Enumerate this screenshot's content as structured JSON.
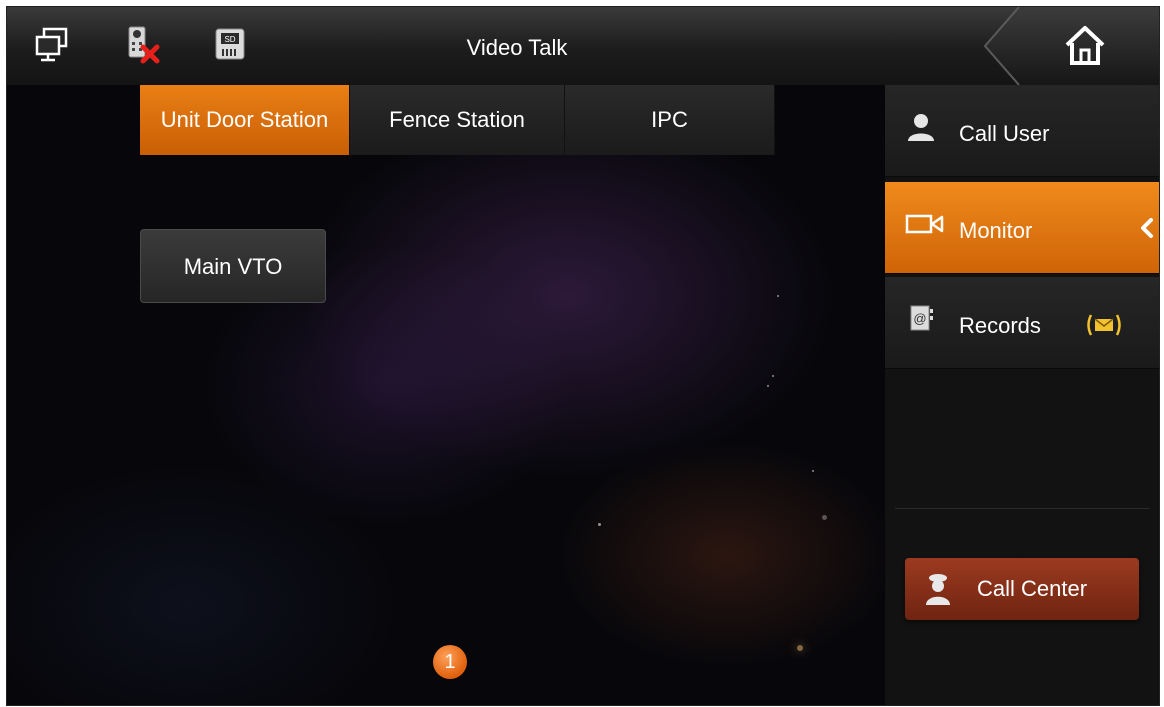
{
  "topbar": {
    "title": "Video Talk",
    "icons": [
      "network-icon",
      "door-station-offline-icon",
      "sd-card-icon",
      "home-icon"
    ]
  },
  "tabs": [
    {
      "label": "Unit Door Station",
      "active": true
    },
    {
      "label": "Fence Station",
      "active": false
    },
    {
      "label": "IPC",
      "active": false
    }
  ],
  "devices": [
    {
      "label": "Main VTO"
    }
  ],
  "pagination": {
    "current_page": "1"
  },
  "sidebar": {
    "items": [
      {
        "label": "Call User",
        "icon": "user-icon",
        "active": false
      },
      {
        "label": "Monitor",
        "icon": "camera-icon",
        "active": true
      },
      {
        "label": "Records",
        "icon": "records-icon",
        "active": false,
        "badge_icon": "envelope-icon"
      }
    ],
    "call_center": {
      "label": "Call Center",
      "icon": "call-center-icon"
    }
  },
  "colors": {
    "accent": "#e97f14",
    "call_center": "#8a3219",
    "background": "#0b0b0f"
  }
}
